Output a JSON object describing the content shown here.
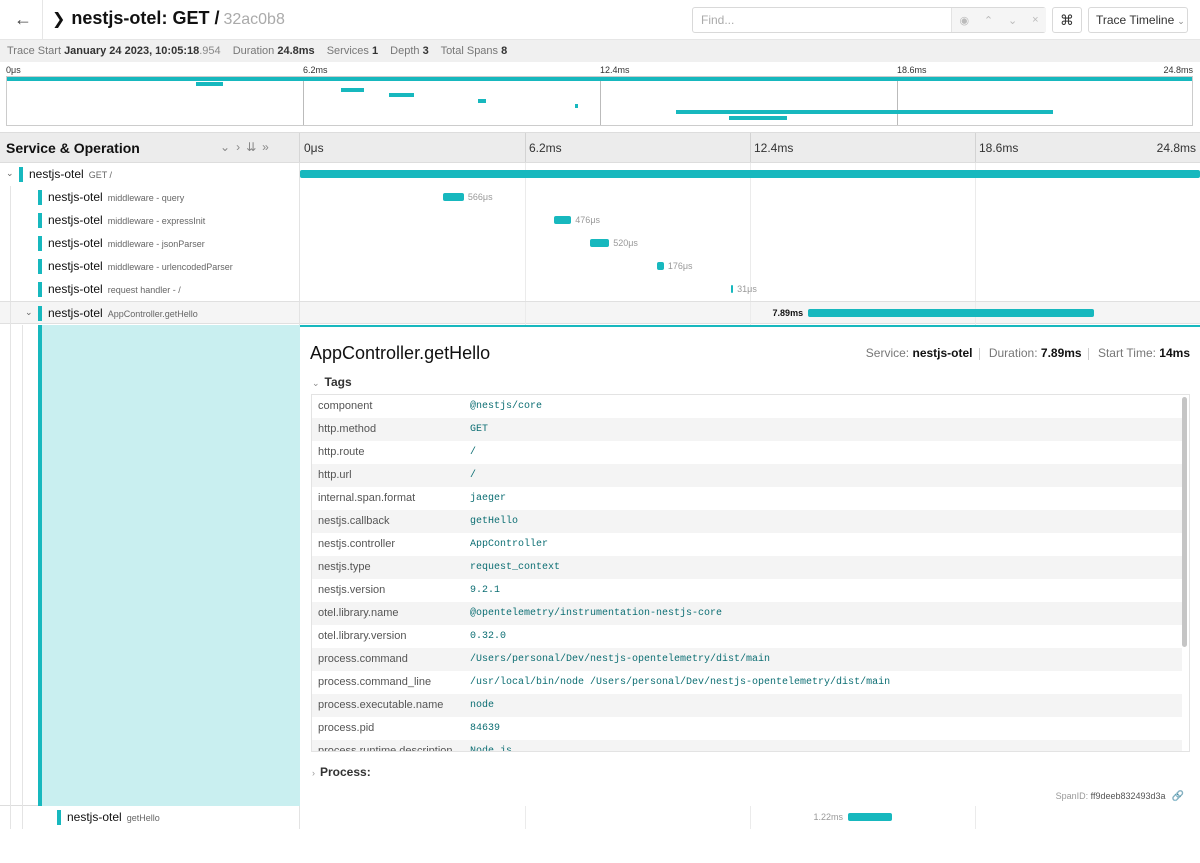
{
  "header": {
    "back_icon": "arrow-left-icon",
    "service": "nestjs-otel",
    "operation": "GET /",
    "trace_id": "32ac0b8",
    "find_placeholder": "Find...",
    "view_label": "Trace Timeline"
  },
  "summary": {
    "trace_start_label": "Trace Start",
    "trace_start_value": "January 24 2023, 10:05:18",
    "trace_start_ms": ".954",
    "duration_label": "Duration",
    "duration_value": "24.8ms",
    "services_label": "Services",
    "services_value": "1",
    "depth_label": "Depth",
    "depth_value": "3",
    "total_spans_label": "Total Spans",
    "total_spans_value": "8"
  },
  "ticks": [
    "0μs",
    "6.2ms",
    "12.4ms",
    "18.6ms",
    "24.8ms"
  ],
  "timeline_header": {
    "title": "Service & Operation"
  },
  "spans": [
    {
      "service": "nestjs-otel",
      "operation": "GET /",
      "depth": 0,
      "start_ms": 0.0,
      "duration_ms": 24.8,
      "duration_label": ""
    },
    {
      "service": "nestjs-otel",
      "operation": "middleware - query",
      "depth": 1,
      "start_ms": 3.95,
      "duration_ms": 0.566,
      "duration_label": "566μs"
    },
    {
      "service": "nestjs-otel",
      "operation": "middleware - expressInit",
      "depth": 1,
      "start_ms": 7.0,
      "duration_ms": 0.476,
      "duration_label": "476μs"
    },
    {
      "service": "nestjs-otel",
      "operation": "middleware - jsonParser",
      "depth": 1,
      "start_ms": 8.0,
      "duration_ms": 0.52,
      "duration_label": "520μs"
    },
    {
      "service": "nestjs-otel",
      "operation": "middleware - urlencodedParser",
      "depth": 1,
      "start_ms": 9.85,
      "duration_ms": 0.176,
      "duration_label": "176μs"
    },
    {
      "service": "nestjs-otel",
      "operation": "request handler - /",
      "depth": 1,
      "start_ms": 11.88,
      "duration_ms": 0.031,
      "duration_label": "31μs"
    },
    {
      "service": "nestjs-otel",
      "operation": "AppController.getHello",
      "depth": 1,
      "start_ms": 14.0,
      "duration_ms": 7.89,
      "duration_label": "7.89ms"
    },
    {
      "service": "nestjs-otel",
      "operation": "getHello",
      "depth": 2,
      "start_ms": 15.1,
      "duration_ms": 1.22,
      "duration_label": "1.22ms"
    }
  ],
  "detail": {
    "title": "AppController.getHello",
    "service_label": "Service:",
    "service_value": "nestjs-otel",
    "duration_label": "Duration:",
    "duration_value": "7.89ms",
    "start_label": "Start Time:",
    "start_value": "14ms",
    "tags_label": "Tags",
    "process_label": "Process:",
    "spanid_label": "SpanID:",
    "spanid_value": "ff9deeb832493d3a",
    "tags": [
      {
        "key": "component",
        "value": "@nestjs/core"
      },
      {
        "key": "http.method",
        "value": "GET"
      },
      {
        "key": "http.route",
        "value": "/"
      },
      {
        "key": "http.url",
        "value": "/"
      },
      {
        "key": "internal.span.format",
        "value": "jaeger"
      },
      {
        "key": "nestjs.callback",
        "value": "getHello"
      },
      {
        "key": "nestjs.controller",
        "value": "AppController"
      },
      {
        "key": "nestjs.type",
        "value": "request_context"
      },
      {
        "key": "nestjs.version",
        "value": "9.2.1"
      },
      {
        "key": "otel.library.name",
        "value": "@opentelemetry/instrumentation-nestjs-core"
      },
      {
        "key": "otel.library.version",
        "value": "0.32.0"
      },
      {
        "key": "process.command",
        "value": "/Users/personal/Dev/nestjs-opentelemetry/dist/main"
      },
      {
        "key": "process.command_line",
        "value": "/usr/local/bin/node /Users/personal/Dev/nestjs-opentelemetry/dist/main"
      },
      {
        "key": "process.executable.name",
        "value": "node"
      },
      {
        "key": "process.pid",
        "value": "84639"
      },
      {
        "key": "process.runtime.description",
        "value": "Node.js"
      }
    ]
  },
  "colors": {
    "accent": "#17b8be",
    "selected_bg": "#c9eff0"
  }
}
